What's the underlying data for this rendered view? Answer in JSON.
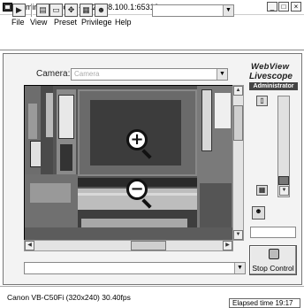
{
  "window": {
    "title": "Admin Livescope - 192.168.100.1:65310",
    "minimize_glyph": "_",
    "maximize_glyph": "□",
    "close_glyph": "×"
  },
  "menu": [
    "File",
    "View",
    "Preset",
    "Privilege",
    "Help"
  ],
  "camera": {
    "label": "Camera:",
    "value": "Camera"
  },
  "branding": {
    "line1": "WebView",
    "line2": "Livescope",
    "badge": "Administrator"
  },
  "video": {
    "zoom_in_glyph": "+",
    "zoom_out_glyph": "−"
  },
  "controls": {
    "stop_button": "Stop Control",
    "bottom_select_value": "",
    "input_value": ""
  },
  "status": {
    "camera_info": "Canon VB-C50Fi (320x240) 30.40fps",
    "elapsed": "Elapsed time 19:17"
  },
  "colors": {
    "panel_bg": "#f3f3f3",
    "badge_bg": "#444444"
  },
  "icons": [
    "app-icon",
    "capture-icon",
    "snapshot-icon",
    "window-icon",
    "ptz-icon",
    "image-icon",
    "user-icon",
    "stop-icon",
    "zoom-in-icon",
    "zoom-out-icon"
  ]
}
